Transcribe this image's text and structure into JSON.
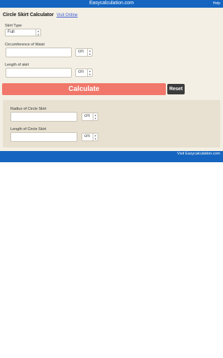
{
  "app": {
    "title": "Easycalculation.com",
    "help": "Help"
  },
  "page": {
    "heading": "Circle Skirt Calculator",
    "visit_link": "Visit Online"
  },
  "form": {
    "skirt_type": {
      "label": "Skirt Type",
      "value": "Full"
    },
    "waist": {
      "label": "Circumference of Waist",
      "unit": "cm"
    },
    "length": {
      "label": "Length of skirt",
      "unit": "cm"
    }
  },
  "actions": {
    "calculate": "Calculate",
    "reset": "Reset"
  },
  "results": {
    "radius": {
      "label": "Radius of Circle Skirt",
      "unit": "cm"
    },
    "length": {
      "label": "Length of Circle Skirt",
      "unit": "cm"
    }
  },
  "footer": {
    "link": "Visit Easycalculation.com"
  }
}
